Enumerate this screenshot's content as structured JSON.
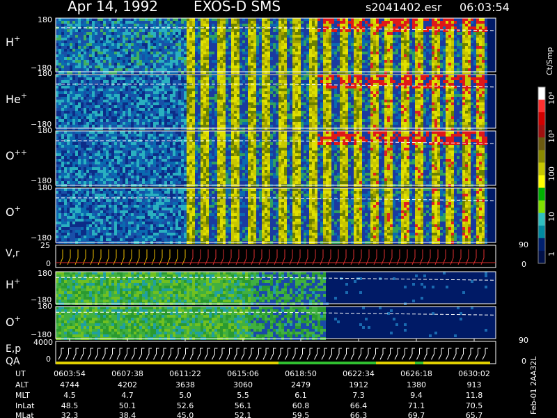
{
  "header": {
    "date": "Apr 14, 1992",
    "instrument": "EXOS-D SMS",
    "file": "s2041402.esr",
    "time": "06:03:54"
  },
  "chart_data": [
    {
      "type": "heatmap",
      "panel": "H+",
      "label_base": "H",
      "label_sup": "+",
      "ylim_labels": [
        "180",
        "−180"
      ],
      "trace": "dashed white"
    },
    {
      "type": "heatmap",
      "panel": "He+",
      "label_base": "He",
      "label_sup": "+",
      "ylim_labels": [
        "180",
        "−180"
      ],
      "trace": "dashed white"
    },
    {
      "type": "heatmap",
      "panel": "O++",
      "label_base": "O",
      "label_sup": "++",
      "ylim_labels": [
        "180",
        "−180"
      ],
      "trace": "dashed white"
    },
    {
      "type": "heatmap",
      "panel": "O+",
      "label_base": "O",
      "label_sup": "+",
      "ylim_labels": [
        "180",
        "−180"
      ],
      "trace": "dashed white"
    },
    {
      "type": "line",
      "panel": "V,r",
      "label": "V,r",
      "left_ticks": [
        "25",
        "0"
      ],
      "right_ticks": [
        "90",
        "0"
      ]
    },
    {
      "type": "heatmap",
      "panel": "H+ (lower)",
      "label_base": "H",
      "label_sup": "+",
      "ylim_labels": [
        "180",
        "−180"
      ],
      "trace": "dashed white"
    },
    {
      "type": "heatmap",
      "panel": "O+ (lower)",
      "label_base": "O",
      "label_sup": "+",
      "ylim_labels": [
        "180",
        "−180"
      ],
      "trace": "dashed white"
    },
    {
      "type": "line",
      "panel": "E,p / QA",
      "label1": "E,p",
      "label2": "QA",
      "left_ticks": [
        "4000",
        "0"
      ],
      "right_ticks": [
        "90",
        "0"
      ]
    }
  ],
  "colorbar": {
    "unit": "Ct/Smp",
    "labels": [
      "10⁴",
      "10³",
      "100",
      "10",
      "1"
    ],
    "colors": [
      "#ffffff",
      "#ff3030",
      "#d00000",
      "#a01010",
      "#6b5a10",
      "#8a8a00",
      "#c8c800",
      "#ffff00",
      "#00b000",
      "#80e000",
      "#30c0c0",
      "#008aa0",
      "#00206e",
      "#001048"
    ]
  },
  "time_axis": {
    "rows": [
      {
        "label": "UT",
        "values": [
          "0603:54",
          "0607:38",
          "0611:22",
          "0615:06",
          "0618:50",
          "0622:34",
          "0626:18",
          "0630:02"
        ]
      },
      {
        "label": "ALT",
        "values": [
          "4744",
          "4202",
          "3638",
          "3060",
          "2479",
          "1912",
          "1380",
          "913"
        ]
      },
      {
        "label": "MLT",
        "values": [
          "4.5",
          "4.7",
          "5.0",
          "5.5",
          "6.1",
          "7.3",
          "9.4",
          "11.8"
        ]
      },
      {
        "label": "InLat",
        "values": [
          "48.5",
          "50.1",
          "52.6",
          "56.1",
          "60.8",
          "66.4",
          "71.1",
          "70.5"
        ]
      },
      {
        "label": "MLat",
        "values": [
          "32.3",
          "38.4",
          "45.0",
          "52.1",
          "59.5",
          "66.3",
          "69.7",
          "65.7"
        ]
      }
    ]
  },
  "footer": {
    "side_note": "Feb-01 2AA32L"
  }
}
